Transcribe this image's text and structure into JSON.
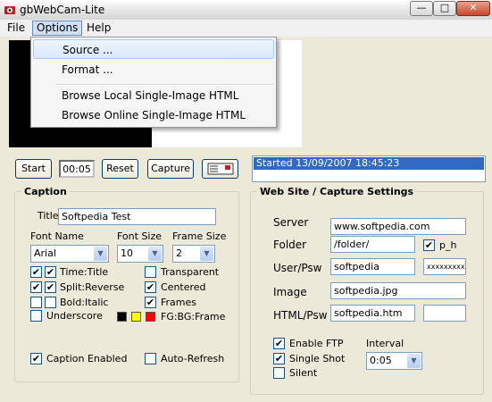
{
  "window": {
    "title": "gbWebCam-Lite"
  },
  "menubar": {
    "file": "File",
    "options": "Options",
    "help": "Help"
  },
  "options_menu": {
    "source": "Source ...",
    "format": "Format ...",
    "browse_local": "Browse Local Single-Image HTML",
    "browse_online": "Browse Online Single-Image HTML"
  },
  "toolbar": {
    "start": "Start",
    "timer": "00:05",
    "reset": "Reset",
    "capture": "Capture"
  },
  "status": {
    "line": "Started 13/09/2007 18:45:23"
  },
  "caption": {
    "group_label": "Caption",
    "title_label": "Title",
    "title_value": "Softpedia Test",
    "font_name_label": "Font Name",
    "font_name_value": "Arial",
    "font_size_label": "Font Size",
    "font_size_value": "10",
    "frame_size_label": "Frame Size",
    "frame_size_value": "2",
    "time_title": "Time:Title",
    "split_reverse": "Split:Reverse",
    "bold_italic": "Bold:Italic",
    "underscore": "Underscore",
    "transparent": "Transparent",
    "centered": "Centered",
    "frames": "Frames",
    "colors_label": "FG:BG:Frame",
    "colors": [
      "#000000",
      "#ffff00",
      "#ff0000"
    ],
    "caption_enabled": "Caption Enabled",
    "auto_refresh": "Auto-Refresh"
  },
  "website": {
    "group_label": "Web Site / Capture Settings",
    "server_label": "Server",
    "server_value": "www.softpedia.com",
    "folder_label": "Folder",
    "folder_value": "/folder/",
    "p_h": "p_h",
    "user_label": "User/Psw",
    "user_value": "softpedia",
    "password_value": "xxxxxxxxx",
    "image_label": "Image",
    "image_value": "softpedia.jpg",
    "html_label": "HTML/Psw",
    "html_value": "softpedia.htm",
    "enable_ftp": "Enable FTP",
    "single_shot": "Single Shot",
    "silent": "Silent",
    "interval_label": "Interval",
    "interval_value": "0:05"
  },
  "checks": {
    "time_title": true,
    "split_reverse": true,
    "bold_italic": false,
    "underscore": false,
    "transparent": false,
    "centered": true,
    "frames": true,
    "caption_enabled": true,
    "auto_refresh": false,
    "p_h": true,
    "enable_ftp": true,
    "single_shot": true,
    "silent": false
  }
}
